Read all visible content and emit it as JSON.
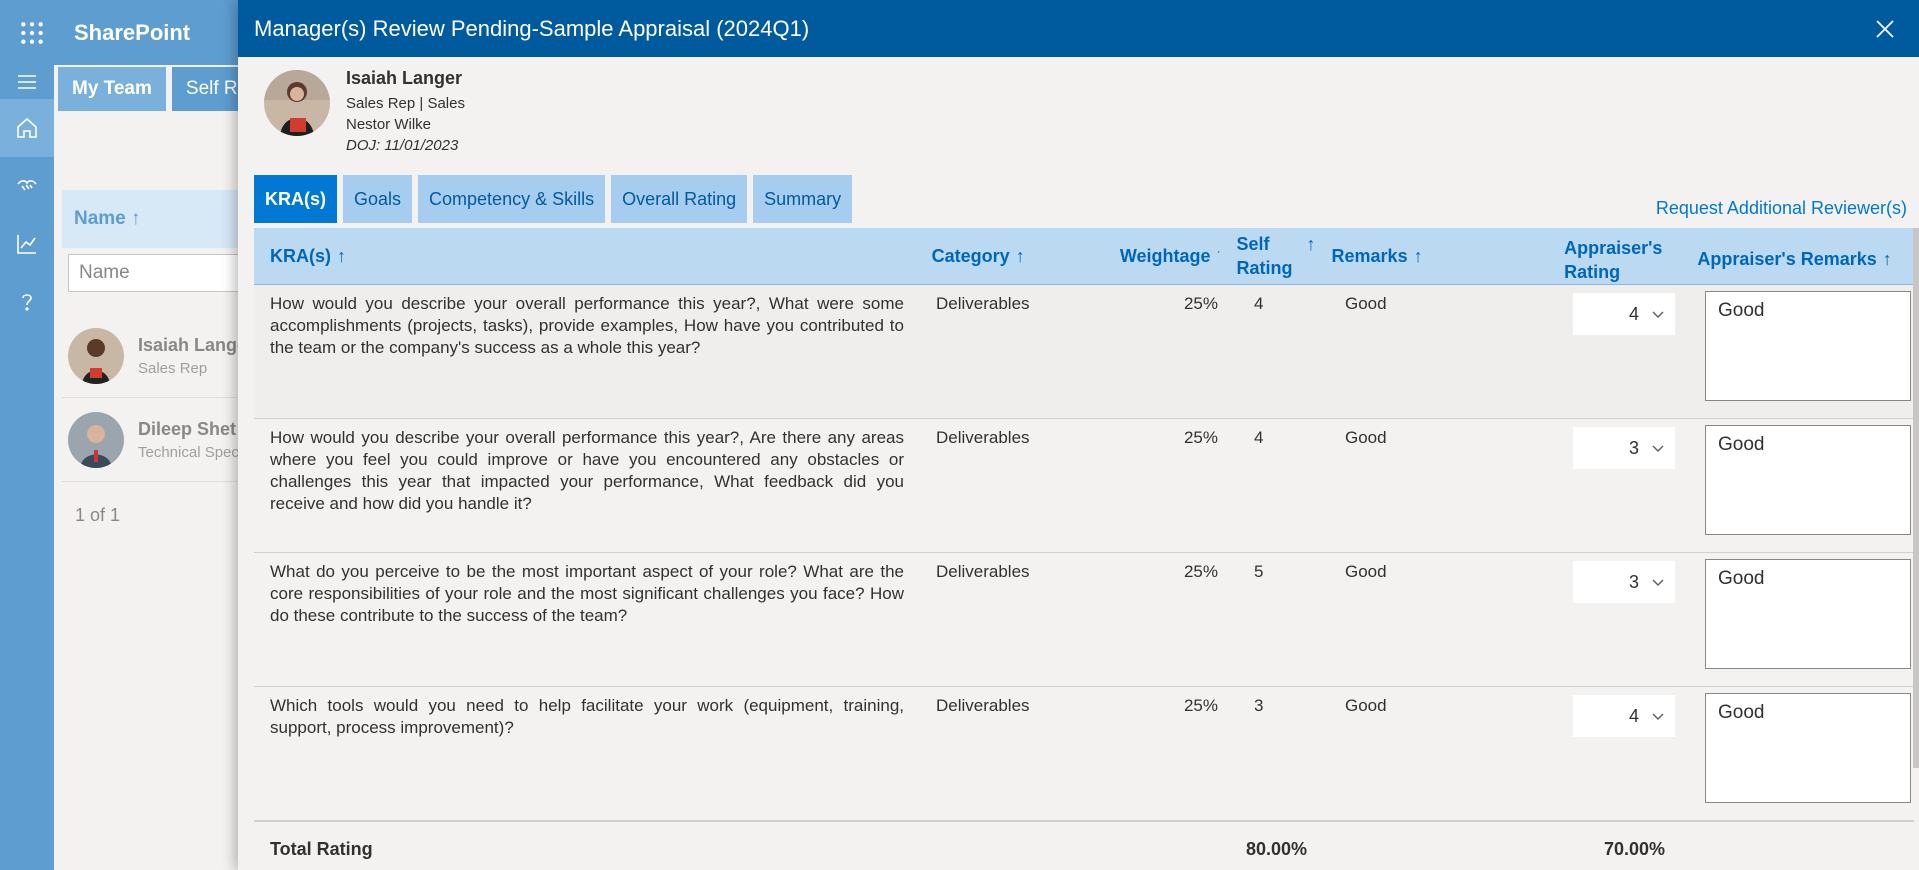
{
  "app": {
    "brand": "SharePoint",
    "bg_tabs": [
      "My Team",
      "Self Re"
    ],
    "bg_name_header": "Name",
    "bg_name_placeholder": "Name",
    "bg_people": [
      {
        "name": "Isaiah Lange",
        "role": "Sales Rep"
      },
      {
        "name": "Dileep Shet",
        "role": "Technical Spec"
      }
    ],
    "bg_pager": "1 of 1"
  },
  "panel": {
    "title": "Manager(s) Review Pending-Sample Appraisal (2024Q1)",
    "employee": {
      "name": "Isaiah Langer",
      "role_dept": "Sales Rep | Sales",
      "manager": "Nestor Wilke",
      "doj": "DOJ: 11/01/2023"
    },
    "tabs": [
      "KRA(s)",
      "Goals",
      "Competency & Skills",
      "Overall Rating",
      "Summary"
    ],
    "request_link": "Request Additional Reviewer(s)",
    "columns": {
      "kra": "KRA(s)",
      "category": "Category",
      "weightage": "Weightage",
      "self_rating_1": "Self",
      "self_rating_2": "Rating",
      "remarks": "Remarks",
      "appr_rating_1": "Appraiser's",
      "appr_rating_2": "Rating",
      "appr_remarks": "Appraiser's Remarks",
      "sort_arrow": "↑"
    },
    "rows": [
      {
        "kra": "How would you describe your overall performance this year?, What were some accomplishments (projects, tasks), provide examples, How have you contributed to the team or the company's success as a whole this year?",
        "category": "Deliverables",
        "weightage": "25%",
        "self_rating": "4",
        "remarks": "Good",
        "appraiser_rating": "4",
        "appraiser_remarks": "Good"
      },
      {
        "kra": "How would you describe your overall performance this year?, Are there any areas where you feel you could improve or have you encountered any obstacles or challenges this year that impacted your performance, What feedback did you receive and how did you handle it?",
        "category": "Deliverables",
        "weightage": "25%",
        "self_rating": "4",
        "remarks": "Good",
        "appraiser_rating": "3",
        "appraiser_remarks": "Good"
      },
      {
        "kra": "What do you perceive to be the most important aspect of your role? What are the core responsibilities of your role and the most significant challenges you face? How do these contribute to the success of the team?",
        "category": "Deliverables",
        "weightage": "25%",
        "self_rating": "5",
        "remarks": "Good",
        "appraiser_rating": "3",
        "appraiser_remarks": "Good"
      },
      {
        "kra": "Which tools would you need to help facilitate your work (equipment, training, support, process improvement)?",
        "category": "Deliverables",
        "weightage": "25%",
        "self_rating": "3",
        "remarks": "Good",
        "appraiser_rating": "4",
        "appraiser_remarks": "Good"
      }
    ],
    "total": {
      "label": "Total Rating",
      "self": "80.00%",
      "appraiser": "70.00%"
    }
  }
}
